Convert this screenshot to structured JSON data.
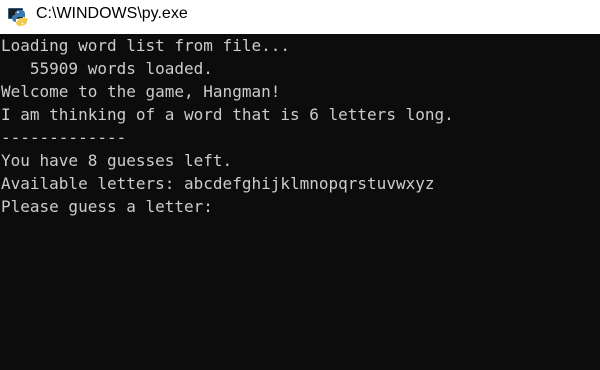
{
  "window": {
    "title": "C:\\WINDOWS\\py.exe",
    "icon": "python-icon"
  },
  "console": {
    "background": "#0c0c0c",
    "foreground": "#cccccc",
    "lines": [
      "Loading word list from file...",
      "   55909 words loaded.",
      "Welcome to the game, Hangman!",
      "I am thinking of a word that is 6 letters long.",
      "-------------",
      "You have 8 guesses left.",
      "Available letters: abcdefghijklmnopqrstuvwxyz",
      "Please guess a letter:"
    ]
  }
}
